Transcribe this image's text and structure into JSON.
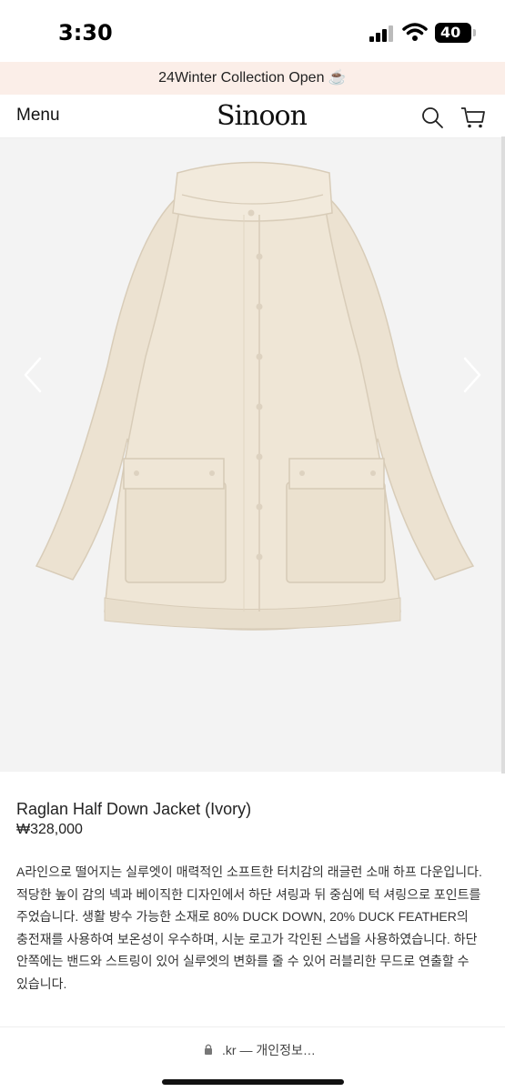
{
  "status_bar": {
    "time": "3:30",
    "battery": "40",
    "icons": [
      "signal-icon",
      "wifi-icon",
      "battery-icon"
    ]
  },
  "announcement": {
    "text": "24Winter Collection Open ☕"
  },
  "header": {
    "menu_label": "Menu",
    "logo_text": "Sinoon",
    "icons": [
      "search-icon",
      "cart-icon"
    ]
  },
  "carousel": {
    "prev_icon": "chevron-left-icon",
    "next_icon": "chevron-right-icon"
  },
  "product": {
    "name": "Raglan Half Down Jacket (Ivory)",
    "price": "₩328,000",
    "description": "A라인으로 떨어지는 실루엣이 매력적인 소프트한 터치감의 래글런 소매 하프 다운입니다. 적당한 높이 감의 넥과 베이직한 디자인에서 하단 셔링과 뒤 중심에 턱 셔링으로 포인트를 주었습니다. 생활 방수 가능한 소재로 80% DUCK DOWN, 20% DUCK FEATHER의 충전재를 사용하여 보온성이 우수하며, 시눈 로고가 각인된 스냅을 사용하였습니다. 하단 안쪽에는 밴드와 스트링이 있어 실루엣의 변화를 줄 수 있어 러블리한 무드로 연출할 수 있습니다."
  },
  "browser": {
    "url_text": ".kr — 개인정보…"
  },
  "colors": {
    "announce_bg": "#fbeee8",
    "jacket": "#efe6d6",
    "image_bg": "#f3f3f3"
  }
}
